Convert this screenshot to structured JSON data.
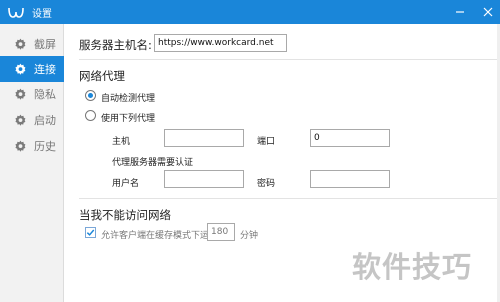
{
  "window": {
    "title": "设置"
  },
  "sidebar": {
    "items": [
      {
        "label": "截屏",
        "icon": "gear-icon",
        "active": false
      },
      {
        "label": "连接",
        "icon": "gear-icon",
        "active": true
      },
      {
        "label": "隐私",
        "icon": "gear-icon",
        "active": false
      },
      {
        "label": "启动",
        "icon": "gear-icon",
        "active": false
      },
      {
        "label": "历史",
        "icon": "gear-icon",
        "active": false
      }
    ]
  },
  "server": {
    "label": "服务器主机名:",
    "value": "https://www.workcard.net"
  },
  "proxy": {
    "title": "网络代理",
    "auto_label": "自动检测代理",
    "manual_label": "使用下列代理",
    "host_label": "主机",
    "host_value": "",
    "port_label": "端口",
    "port_value": "0",
    "auth_label": "代理服务器需要认证",
    "user_label": "用户名",
    "user_value": "",
    "password_label": "密码",
    "password_value": ""
  },
  "offline": {
    "title": "当我不能访问网络",
    "checkbox_label": "允许客户端在缓存模式下运行",
    "minutes_value": "180",
    "minutes_unit": "分钟"
  },
  "watermark": "软件技巧",
  "colors": {
    "accent": "#1a86d9",
    "sidebar_bg": "#f2f2f2"
  }
}
